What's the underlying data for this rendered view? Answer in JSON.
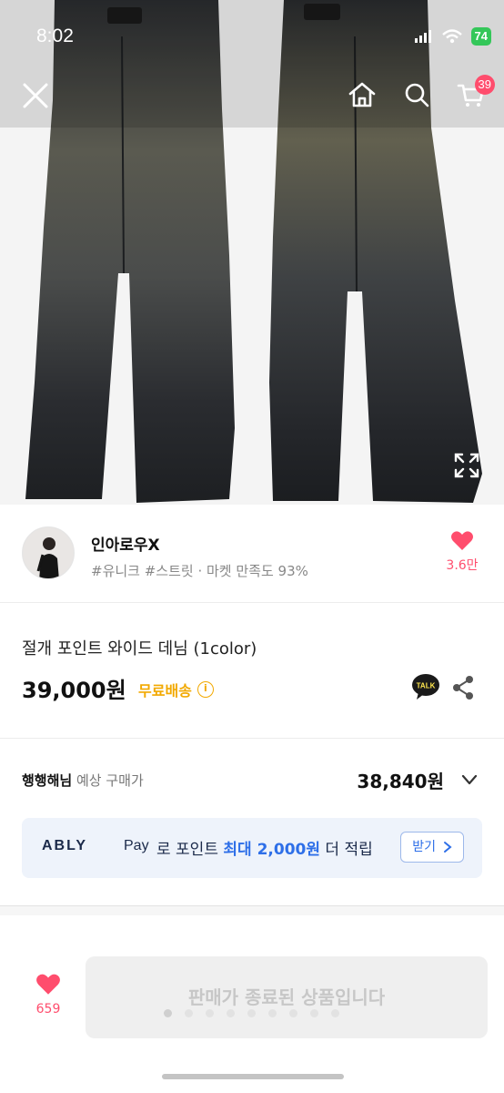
{
  "status_bar": {
    "time": "8:02",
    "battery": "74"
  },
  "hero": {
    "image": "wide-leg-denim-jeans-photo"
  },
  "header": {
    "cart_count": "39"
  },
  "seller": {
    "name": "인아로우X",
    "tags": "#유니크 #스트릿 · 마켓 만족도 93%",
    "like_count": "3.6만"
  },
  "product": {
    "name": "절개 포인트 와이드 데님 (1color)",
    "price": "39,000원",
    "shipping": "무료배송",
    "talk_label": "TALK"
  },
  "expected": {
    "user": "행행해님",
    "label": "예상 구매가",
    "price": "38,840원"
  },
  "banner": {
    "logo": "ABLY",
    "pay": "Pay",
    "text_before": "로 포인트",
    "highlight": "최대 2,000원",
    "text_after": "더 적립",
    "button": "받기"
  },
  "bottom": {
    "like_count": "659",
    "sold_out": "판매가 종료된 상품입니다"
  },
  "colors": {
    "accent_pink": "#ff4d6d",
    "shipping_yellow": "#f2a900",
    "ably_blue": "#2e6fe8"
  }
}
